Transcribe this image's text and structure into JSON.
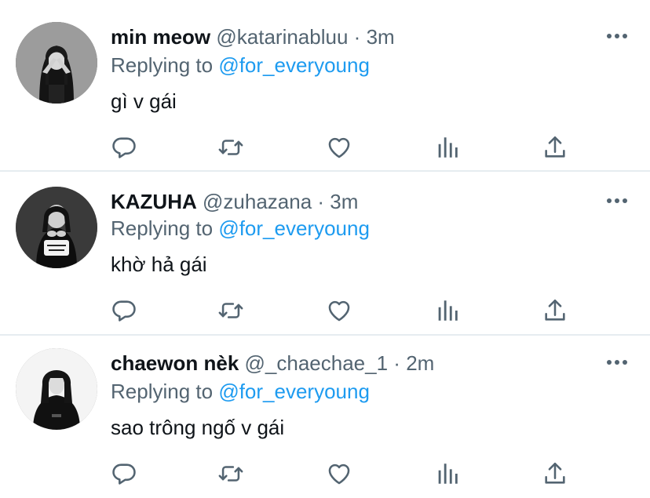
{
  "tweets": [
    {
      "display_name": "min meow",
      "handle": "@katarinabluu",
      "separator": "·",
      "time": "3m",
      "replying_prefix": "Replying to ",
      "replying_to": "@for_everyoung",
      "text": "gì v gái"
    },
    {
      "display_name": "KAZUHA",
      "handle": "@zuhazana",
      "separator": "·",
      "time": "3m",
      "replying_prefix": "Replying to ",
      "replying_to": "@for_everyoung",
      "text": "khờ hả gái"
    },
    {
      "display_name": "chaewon nèk",
      "handle": "@_chaechae_1",
      "separator": "·",
      "time": "2m",
      "replying_prefix": "Replying to ",
      "replying_to": "@for_everyoung",
      "text": "sao trông ngố v gái"
    }
  ],
  "icons": {
    "more": "more-horizontal-icon",
    "reply": "reply-bubble-icon",
    "retweet": "retweet-icon",
    "like": "heart-icon",
    "views": "analytics-bars-icon",
    "share": "share-upload-icon"
  },
  "colors": {
    "text": "#0f1419",
    "secondary": "#536471",
    "link": "#1d9bf0",
    "separator": "#e6ecf0",
    "icon": "#536471"
  }
}
